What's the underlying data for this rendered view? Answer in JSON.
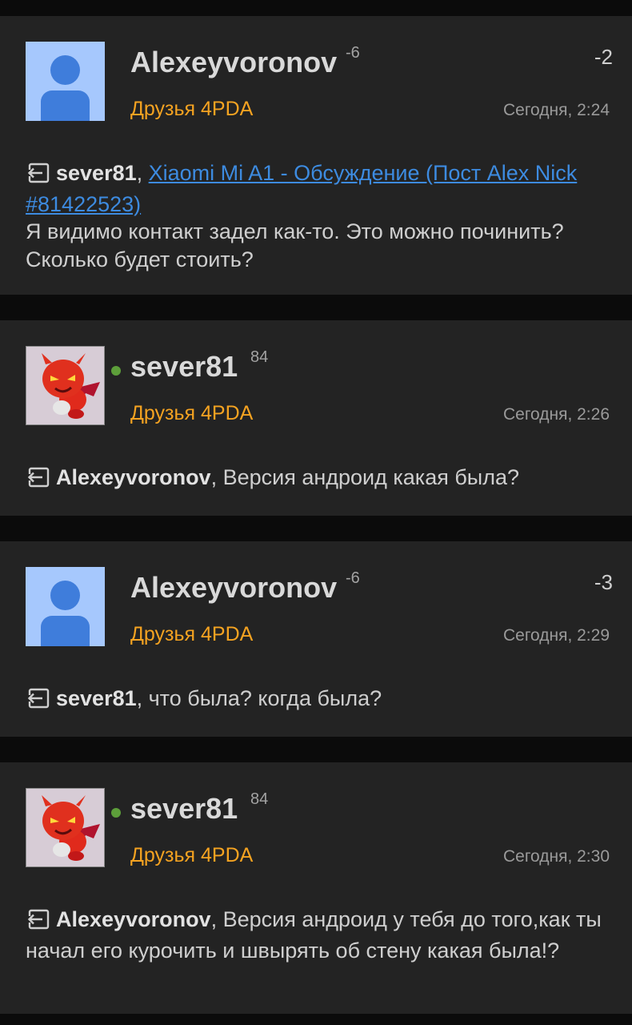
{
  "posts": [
    {
      "author": "Alexeyvoronov",
      "reputation": "-6",
      "group": "Друзья 4PDA",
      "time": "Сегодня, 2:24",
      "score": "-2",
      "reply_to": "sever81",
      "quote_link": "Xiaomi Mi A1 - Обсуждение (Пост Alex Nick #81422523)",
      "text": "Я видимо контакт задел как-то. Это можно починить? Сколько будет стоить?"
    },
    {
      "author": "sever81",
      "reputation": "84",
      "group": "Друзья 4PDA",
      "time": "Сегодня, 2:26",
      "reply_to": "Alexeyvoronov",
      "text": ", Версия андроид какая была?"
    },
    {
      "author": "Alexeyvoronov",
      "reputation": "-6",
      "group": "Друзья 4PDA",
      "time": "Сегодня, 2:29",
      "score": "-3",
      "reply_to": "sever81",
      "text": ", что была? когда была?"
    },
    {
      "author": "sever81",
      "reputation": "84",
      "group": "Друзья 4PDA",
      "time": "Сегодня, 2:30",
      "reply_to": "Alexeyvoronov",
      "text": ", Версия андроид у тебя до того,как ты начал его курочить и швырять об стену какая была!?"
    }
  ],
  "icons": {
    "reply": "reply-arrow-icon",
    "default_avatar": "default-user-avatar-icon",
    "devil_avatar": "red-devil-avatar",
    "online": "online-status-dot"
  },
  "colors": {
    "background": "#0b0b0b",
    "card": "#232323",
    "group": "#f5a321",
    "link": "#3d8be0",
    "online": "#5d9e3a"
  }
}
